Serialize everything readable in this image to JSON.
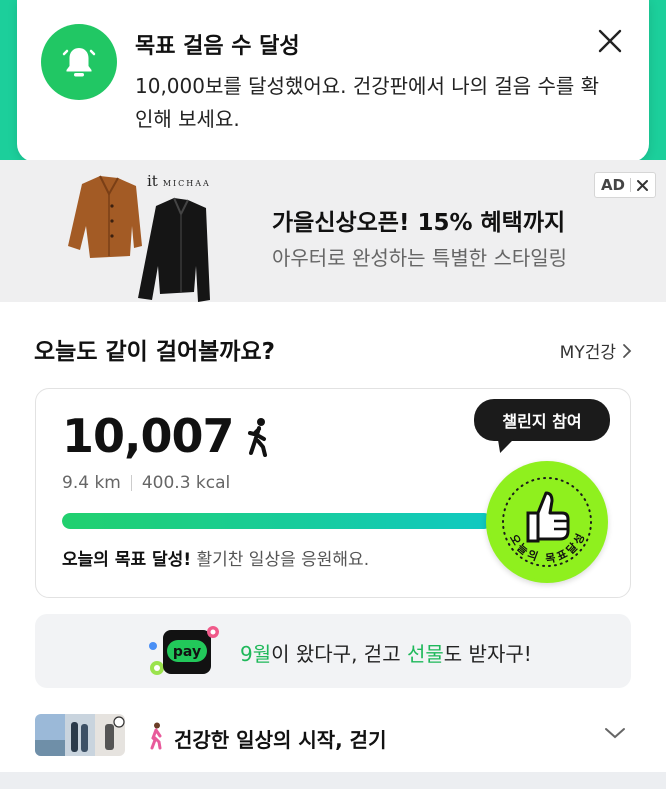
{
  "notification": {
    "title": "목표 걸음 수 달성",
    "body": "10,000보를 달성했어요. 건강판에서 나의 걸음 수를 확인해 보세요.",
    "icon": "bell-icon",
    "accent_color": "#21c764"
  },
  "ad": {
    "brand": "it",
    "brand_sub": "MICHAA",
    "headline": "가을신상오픈! 15% 혜택까지",
    "subline": "아우터로 완성하는 특별한 스타일링",
    "badge_label": "AD"
  },
  "walk_section": {
    "title": "오늘도 같이 걸어볼까요?",
    "my_health_label": "MY건강",
    "steps": "10,007",
    "distance": "9.4 km",
    "calories": "400.3 kcal",
    "progress_fraction": 1.0,
    "goal_bold": "오늘의 목표 달성!",
    "goal_rest": " 활기찬 일상을 응원해요.",
    "challenge_label": "챌린지 참여",
    "stamp_text": "오늘의 목표달성"
  },
  "pay_banner": {
    "pay_label": "pay",
    "text_part1": "9월",
    "text_part2": "이 왔다구, 걷고 ",
    "text_part3": "선물",
    "text_part4": "도 받자구!"
  },
  "walk_row": {
    "title": "건강한 일상의 시작, 걷기"
  }
}
